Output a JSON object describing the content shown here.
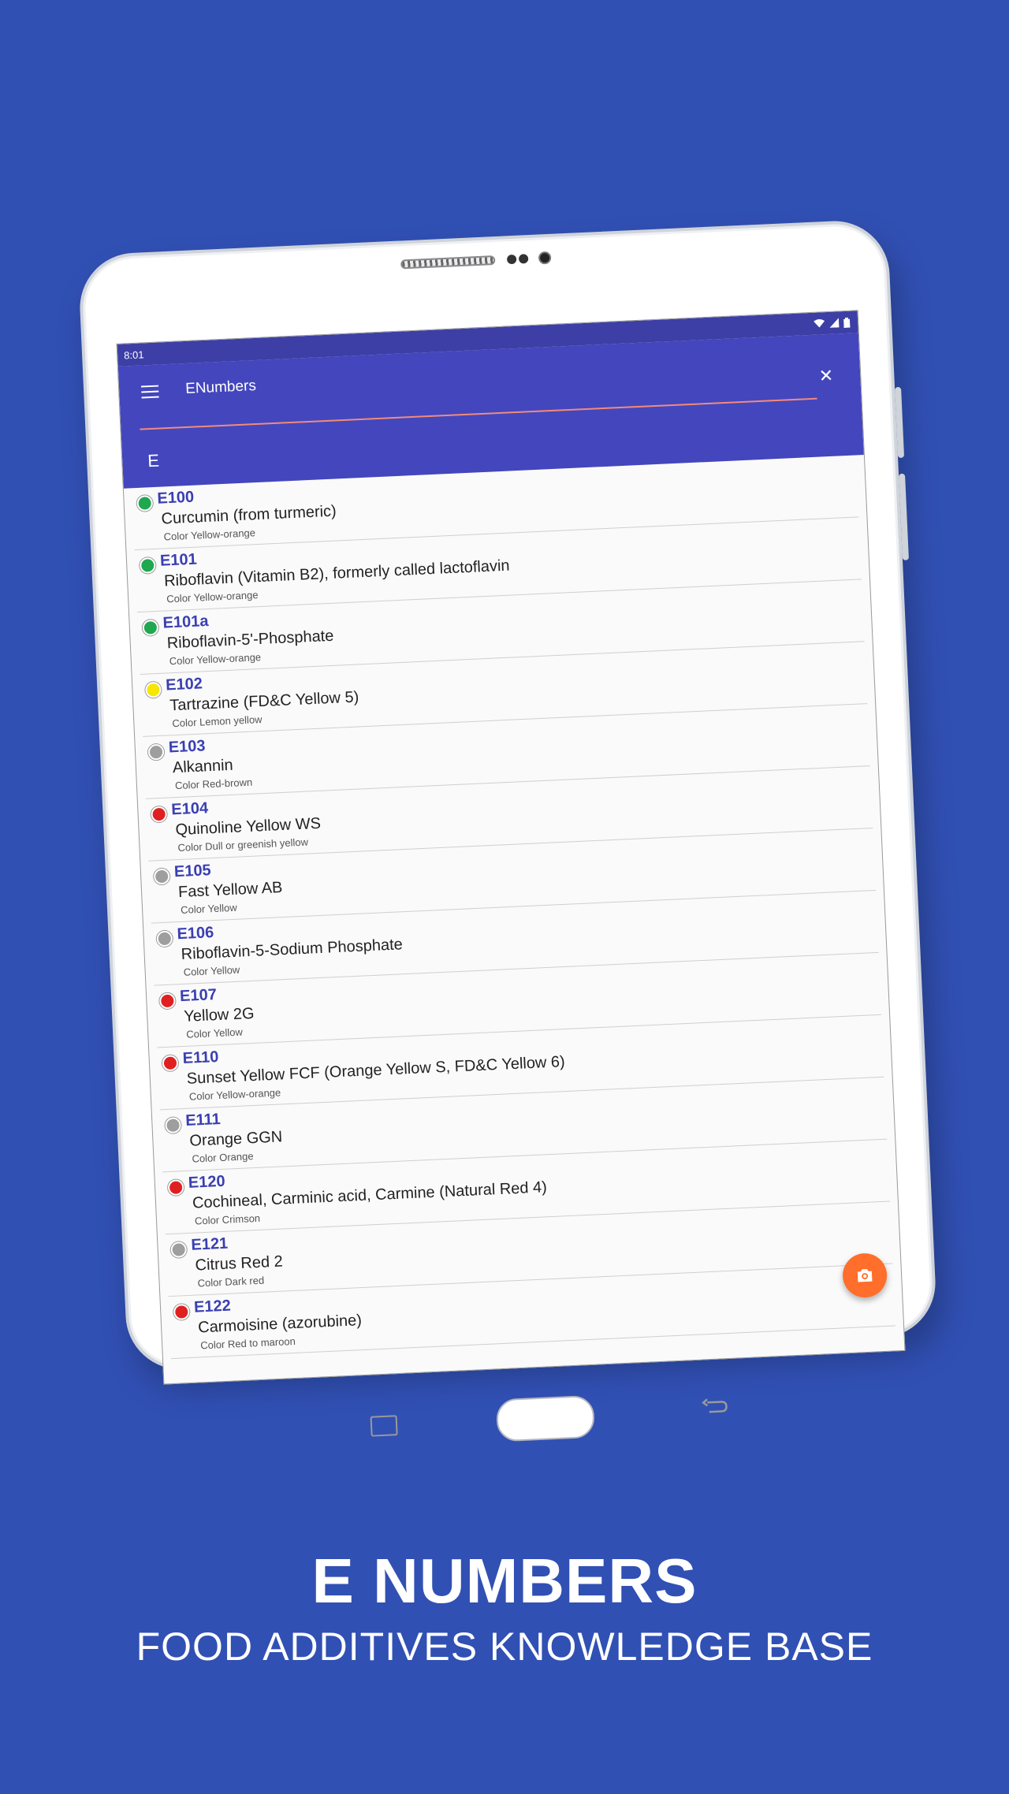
{
  "status_bar": {
    "time": "8:01"
  },
  "app": {
    "title": "ENumbers"
  },
  "search": {
    "value": "E"
  },
  "colors": {
    "green": "#1fa84f",
    "yellow": "#f7e600",
    "gray": "#9e9e9e",
    "red": "#e02020",
    "accent": "#4446bd",
    "fab": "#ff6e2a"
  },
  "items": [
    {
      "code": "E100",
      "name": "Curcumin (from turmeric)",
      "sub": "Color Yellow-orange",
      "status": "green"
    },
    {
      "code": "E101",
      "name": "Riboflavin (Vitamin B2), formerly called lactoflavin",
      "sub": "Color Yellow-orange",
      "status": "green"
    },
    {
      "code": "E101a",
      "name": "Riboflavin-5'-Phosphate",
      "sub": "Color Yellow-orange",
      "status": "green"
    },
    {
      "code": "E102",
      "name": "Tartrazine (FD&C Yellow 5)",
      "sub": "Color Lemon yellow",
      "status": "yellow"
    },
    {
      "code": "E103",
      "name": "Alkannin",
      "sub": "Color Red-brown",
      "status": "gray"
    },
    {
      "code": "E104",
      "name": "Quinoline Yellow WS",
      "sub": "Color Dull or greenish yellow",
      "status": "red"
    },
    {
      "code": "E105",
      "name": "Fast Yellow AB",
      "sub": "Color Yellow",
      "status": "gray"
    },
    {
      "code": "E106",
      "name": "Riboflavin-5-Sodium Phosphate",
      "sub": "Color Yellow",
      "status": "gray"
    },
    {
      "code": "E107",
      "name": "Yellow 2G",
      "sub": "Color Yellow",
      "status": "red"
    },
    {
      "code": "E110",
      "name": "Sunset Yellow FCF (Orange Yellow S, FD&C Yellow 6)",
      "sub": "Color Yellow-orange",
      "status": "red"
    },
    {
      "code": "E111",
      "name": "Orange GGN",
      "sub": "Color Orange",
      "status": "gray"
    },
    {
      "code": "E120",
      "name": "Cochineal, Carminic acid, Carmine (Natural Red 4)",
      "sub": "Color Crimson",
      "status": "red"
    },
    {
      "code": "E121",
      "name": "Citrus Red 2",
      "sub": "Color Dark red",
      "status": "gray"
    },
    {
      "code": "E122",
      "name": "Carmoisine (azorubine)",
      "sub": "Color Red to maroon",
      "status": "red"
    }
  ],
  "promo": {
    "headline": "E NUMBERS",
    "subline": "FOOD ADDITIVES KNOWLEDGE BASE"
  }
}
